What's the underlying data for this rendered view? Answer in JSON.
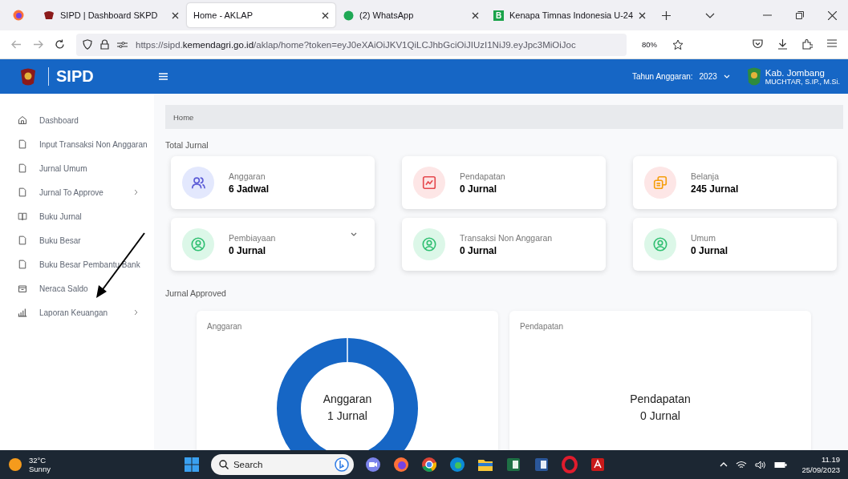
{
  "browser": {
    "tabs": [
      {
        "title": "SIPD | Dashboard SKPD",
        "kind": "emblem",
        "selected": false
      },
      {
        "title": "Home - AKLAP",
        "kind": "plain",
        "selected": true
      },
      {
        "title": "(2) WhatsApp",
        "kind": "whatsapp",
        "selected": false
      },
      {
        "title": "Kenapa Timnas Indonesia U-24",
        "kind": "letter",
        "letter": "B",
        "selected": false
      }
    ],
    "url_host_prefix": "https://sipd.",
    "url_host": "kemendagri.go.id",
    "url_path": "/aklap/home?token=eyJ0eXAiOiJKV1QiLCJhbGciOiJIUzI1NiJ9.eyJpc3MiOiJoc",
    "zoom": "80%"
  },
  "header": {
    "app_name": "SIPD",
    "year_label": "Tahun Anggaran:",
    "year": "2023",
    "region": "Kab. Jombang",
    "user": "MUCHTAR, S.IP., M.Si."
  },
  "sidebar": {
    "items": [
      {
        "label": "Dashboard",
        "kind": "home",
        "submenu": false
      },
      {
        "label": "Input Transaksi Non Anggaran",
        "kind": "file",
        "submenu": false
      },
      {
        "label": "Jurnal Umum",
        "kind": "file",
        "submenu": false
      },
      {
        "label": "Jurnal To Approve",
        "kind": "file",
        "submenu": true
      },
      {
        "label": "Buku Jurnal",
        "kind": "book",
        "submenu": false
      },
      {
        "label": "Buku Besar",
        "kind": "file",
        "submenu": false
      },
      {
        "label": "Buku Besar Pembantu Bank",
        "kind": "file",
        "submenu": false
      },
      {
        "label": "Neraca Saldo",
        "kind": "box",
        "submenu": false
      },
      {
        "label": "Laporan Keuangan",
        "kind": "bars",
        "submenu": true
      }
    ]
  },
  "breadcrumb": "Home",
  "total_section": "Total Jurnal",
  "cards": [
    {
      "label": "Anggaran",
      "value": "6 Jadwal",
      "kind": "users",
      "color": "#e3e8fd",
      "dropdown": false
    },
    {
      "label": "Pendapatan",
      "value": "0 Jurnal",
      "kind": "chart",
      "color": "#fde6e6",
      "dropdown": false
    },
    {
      "label": "Belanja",
      "value": "245 Jurnal",
      "kind": "copy",
      "color": "#fde6e6",
      "dropdown": false
    },
    {
      "label": "Pembiayaan",
      "value": "0 Jurnal",
      "kind": "user",
      "color": "#dcf7e8",
      "dropdown": true
    },
    {
      "label": "Transaksi Non Anggaran",
      "value": "0 Jurnal",
      "kind": "user",
      "color": "#dcf7e8",
      "dropdown": false
    },
    {
      "label": "Umum",
      "value": "0 Jurnal",
      "kind": "user",
      "color": "#dcf7e8",
      "dropdown": false
    }
  ],
  "approved_section": "Jurnal Approved",
  "approved_charts": [
    {
      "title": "Anggaran",
      "center_label": "Anggaran",
      "center_value": "1 Jurnal",
      "ring": true
    },
    {
      "title": "Pendapatan",
      "center_label": "Pendapatan",
      "center_value": "0 Jurnal",
      "ring": false
    }
  ],
  "taskbar": {
    "temperature": "32°C",
    "weather": "Sunny",
    "search": "Search",
    "time": "11.19",
    "date": "25/09/2023"
  }
}
